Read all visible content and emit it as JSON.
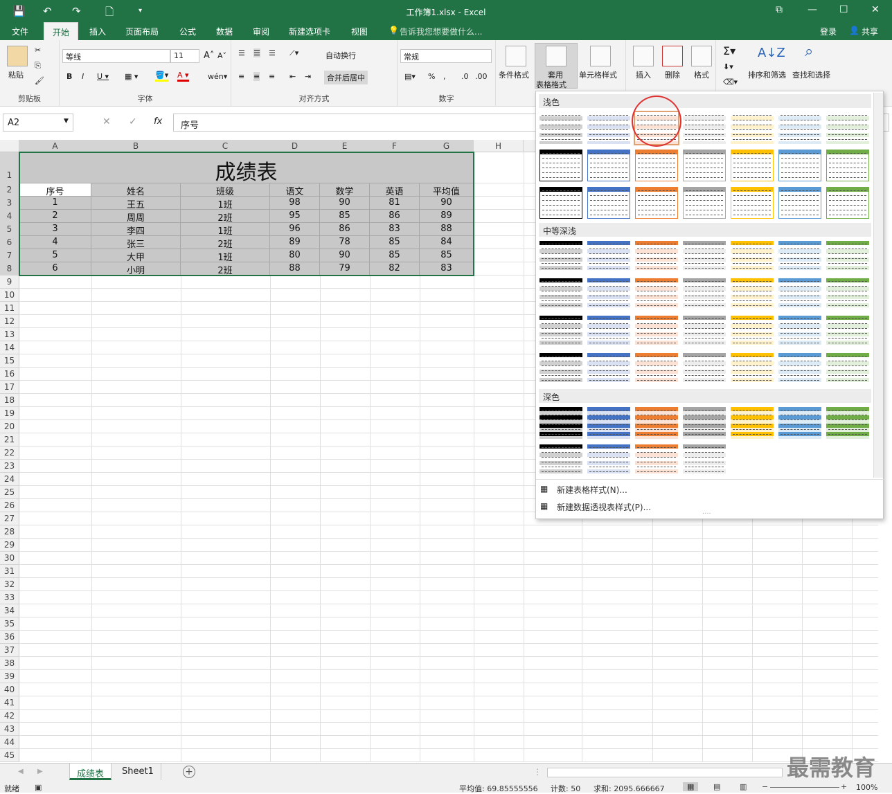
{
  "title": "工作簿1.xlsx - Excel",
  "quick_access": {
    "save": "save-icon",
    "undo": "undo-icon",
    "redo": "redo-icon",
    "new": "new-icon"
  },
  "tabs": [
    "文件",
    "开始",
    "插入",
    "页面布局",
    "公式",
    "数据",
    "审阅",
    "新建选项卡",
    "视图"
  ],
  "tell_me": "告诉我您想要做什么...",
  "login": "登录",
  "share": "共享",
  "ribbon": {
    "clipboard": {
      "label": "剪贴板",
      "paste": "粘贴"
    },
    "font": {
      "label": "字体",
      "name": "等线",
      "size": "11"
    },
    "align": {
      "label": "对齐方式",
      "wrap": "自动换行",
      "merge": "合并后居中"
    },
    "number": {
      "label": "数字",
      "format": "常规"
    },
    "styles": {
      "cond": "条件格式",
      "table": "套用\n表格格式",
      "table1": "套用",
      "table2": "表格格式",
      "cell": "单元格样式"
    },
    "cells": {
      "insert": "插入",
      "delete": "删除",
      "format": "格式"
    },
    "editing": {
      "sort": "排序和筛选",
      "find": "查找和选择"
    }
  },
  "formula_bar": {
    "name_box": "A2",
    "fx": "fx",
    "value": "序号"
  },
  "columns": [
    "A",
    "B",
    "C",
    "D",
    "E",
    "F",
    "G",
    "H"
  ],
  "row_numbers": [
    "1",
    "2",
    "3",
    "4",
    "5",
    "6",
    "7",
    "8",
    "9",
    "10",
    "11",
    "12",
    "13",
    "14",
    "15",
    "16",
    "17",
    "18",
    "19",
    "20",
    "21",
    "22",
    "23",
    "24",
    "25",
    "26",
    "27",
    "28",
    "29",
    "30",
    "31",
    "32",
    "33",
    "34",
    "35",
    "36",
    "37",
    "38",
    "39",
    "40",
    "41",
    "42",
    "43",
    "44",
    "45"
  ],
  "sheet": {
    "title": "成绩表",
    "headers": [
      "序号",
      "姓名",
      "班级",
      "语文",
      "数学",
      "英语",
      "平均值"
    ],
    "rows": [
      [
        "1",
        "王五",
        "1班",
        "98",
        "90",
        "81",
        "90"
      ],
      [
        "2",
        "周周",
        "2班",
        "95",
        "85",
        "86",
        "89"
      ],
      [
        "3",
        "李四",
        "1班",
        "96",
        "86",
        "83",
        "88"
      ],
      [
        "4",
        "张三",
        "2班",
        "89",
        "78",
        "85",
        "84"
      ],
      [
        "5",
        "大甲",
        "1班",
        "80",
        "90",
        "85",
        "85"
      ],
      [
        "6",
        "小明",
        "2班",
        "88",
        "79",
        "82",
        "83"
      ]
    ]
  },
  "gallery": {
    "sections": [
      "浅色",
      "中等深浅",
      "深色"
    ],
    "menu": [
      "新建表格样式(N)...",
      "新建数据透视表样式(P)..."
    ],
    "colors": [
      "#000000",
      "#4472c4",
      "#ed7d31",
      "#a5a5a5",
      "#ffc000",
      "#5b9bd5",
      "#70ad47"
    ]
  },
  "sheet_tabs": [
    "成绩表",
    "Sheet1"
  ],
  "status": {
    "ready": "就绪",
    "average": "平均值: 69.85555556",
    "count": "计数: 50",
    "sum": "求和: 2095.666667",
    "zoom": "100%"
  },
  "watermark": "最需教育"
}
